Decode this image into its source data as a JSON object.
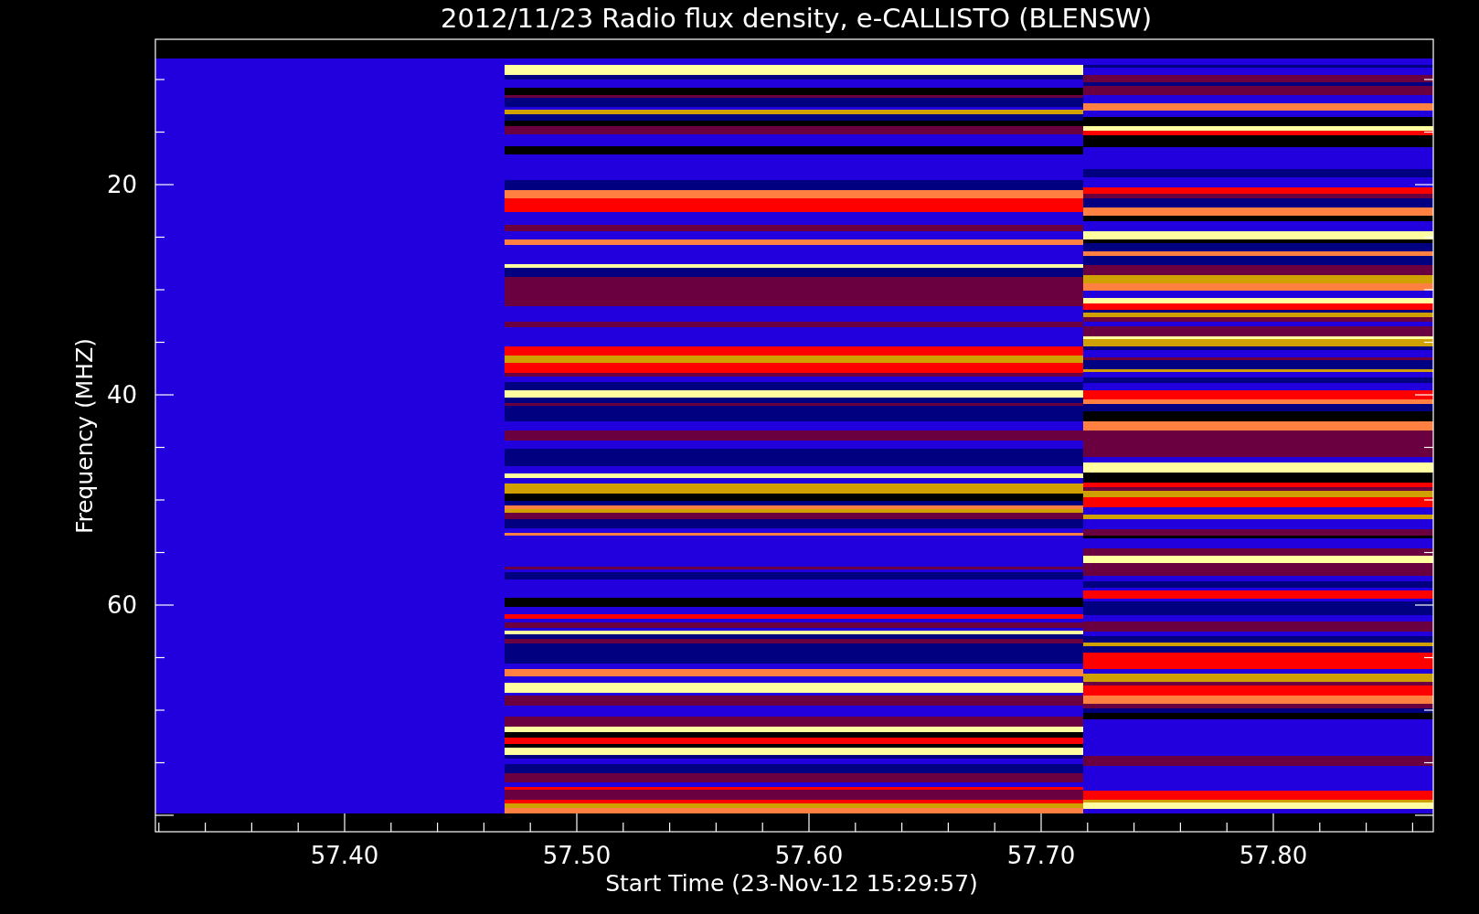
{
  "title": "2012/11/23  Radio flux density, e-CALLISTO (BLENSW)",
  "plot": {
    "xlabel": "Start Time (23-Nov-12 15:29:57)",
    "ylabel": "Frequency (MHZ)",
    "xticks": [
      "57.40",
      "57.50",
      "57.60",
      "57.70",
      "57.80"
    ],
    "yticks": [
      "20",
      "40",
      "60"
    ]
  }
}
